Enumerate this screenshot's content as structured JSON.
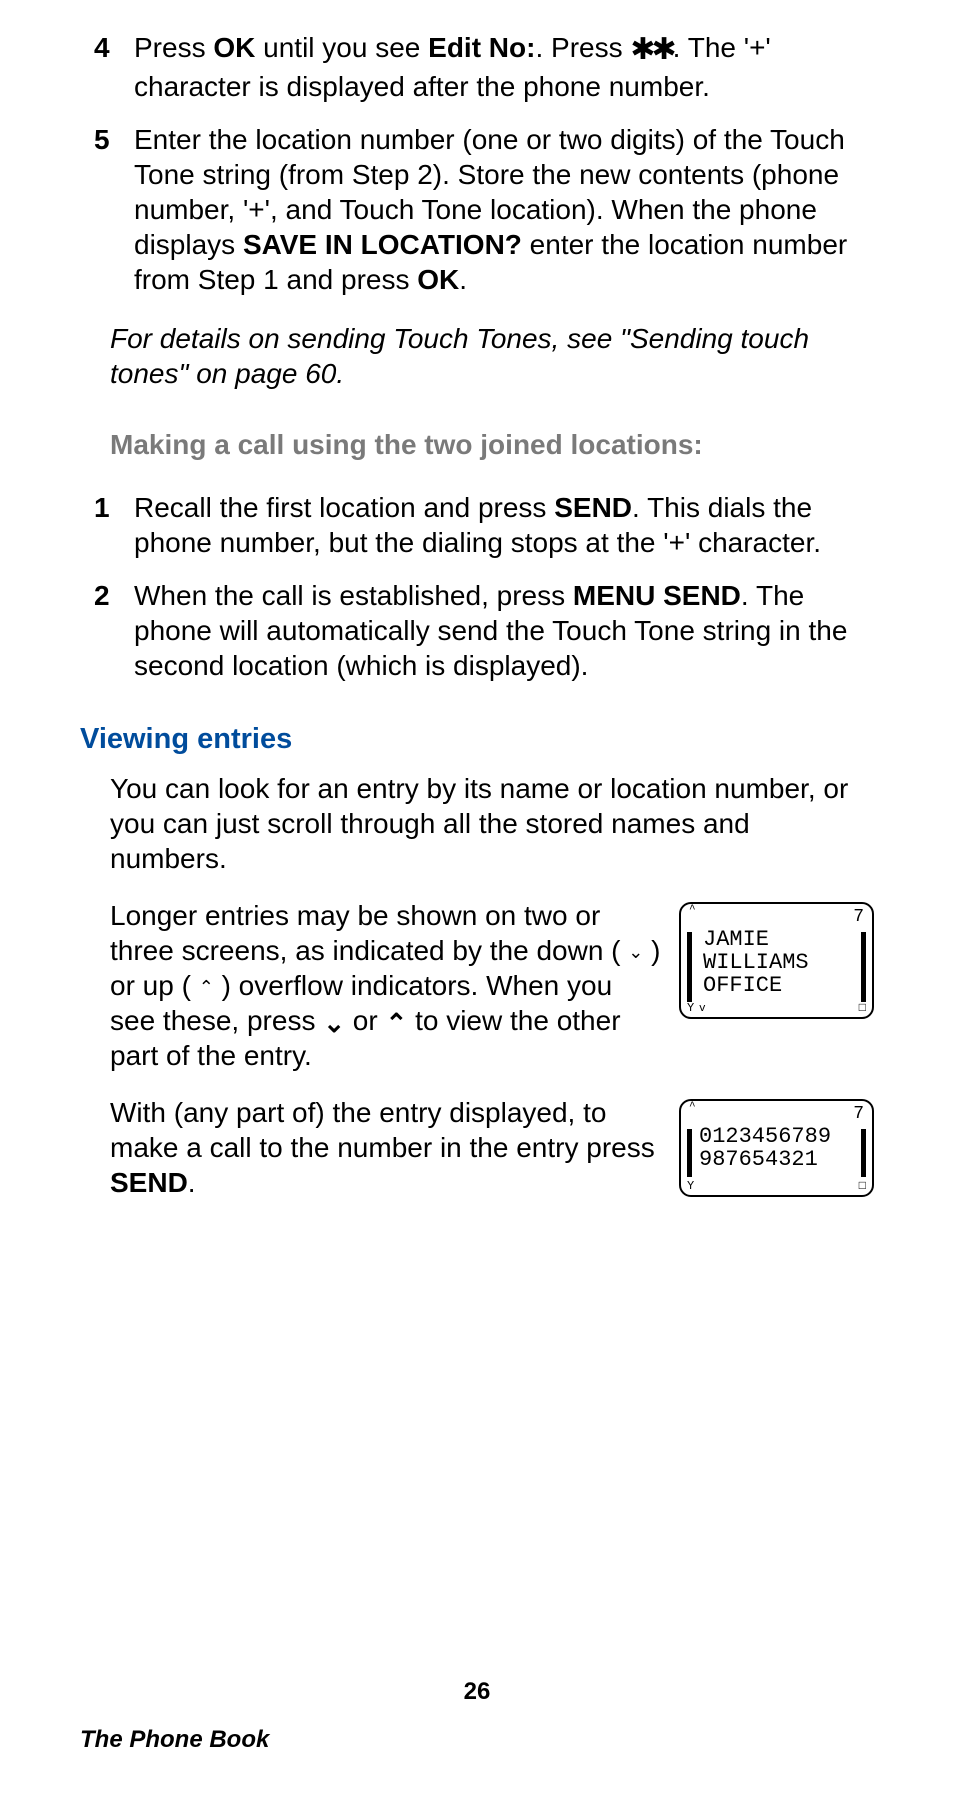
{
  "steps_top": [
    {
      "num": "4",
      "pre": "Press ",
      "b1": "OK",
      "mid1": " until you see ",
      "b2": "Edit No:",
      "mid2": ". Press ",
      "stars": "✱✱",
      "post": ". The '+' character is displayed after the phone number."
    },
    {
      "num": "5",
      "pre": "Enter the location number (one or two digits) of the Touch Tone string (from Step 2). Store the new contents (phone number, '+', and Touch Tone location). When the phone displays ",
      "b1": "SAVE IN LOCATION?",
      "mid1": " enter the location number from Step 1 and press ",
      "b2": "OK",
      "post": "."
    }
  ],
  "italic_note": "For details on sending Touch Tones, see \"Sending touch tones\" on page 60.",
  "gray_head": "Making a call using the two joined locations:",
  "steps_mid": [
    {
      "num": "1",
      "pre": "Recall the first location and press ",
      "b1": "SEND",
      "post": ". This dials the phone number, but the dialing stops at the '+' character."
    },
    {
      "num": "2",
      "pre": "When the call is established, press ",
      "b1": "MENU SEND",
      "post": ". The phone will automatically send the Touch Tone string in the second location (which is displayed)."
    }
  ],
  "blue_head": "Viewing entries",
  "view_para1": "You can look for an entry by its name or location number, or you can just scroll through all the stored names and numbers.",
  "view_para2": {
    "a": "Longer entries may be shown on two or three screens, as indicated by the down ( ",
    "down_small": "⌄",
    "b": " ) or up ( ",
    "up_small": "⌃",
    "c": " ) overflow indicators. When you see these, press ",
    "down_big": "⌄",
    "d": " or ",
    "up_big": "⌃",
    "e": " to view the other part of the entry."
  },
  "view_para3": {
    "a": "With (any part of) the entry displayed, to make a call to the number in the entry press ",
    "b": "SEND",
    "c": "."
  },
  "lcd1": {
    "corner": "7",
    "line1": "JAMIE",
    "line2": "WILLIAMS",
    "line3": "OFFICE",
    "bl": "Y",
    "br": "□"
  },
  "lcd2": {
    "corner": "7",
    "line1": "0123456789",
    "line2": "987654321",
    "bl": "Y",
    "br": "□"
  },
  "page_number": "26",
  "footer_title": "The Phone Book"
}
